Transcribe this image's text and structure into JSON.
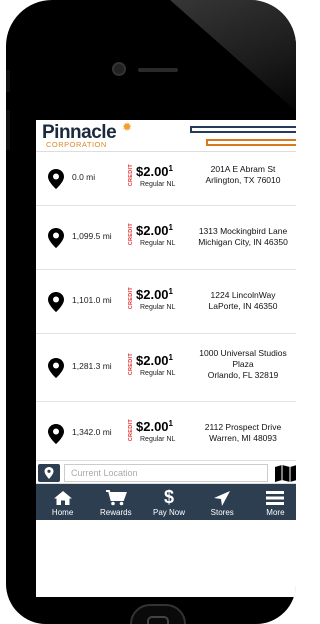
{
  "header": {
    "logo_text": "Pinnacle",
    "logo_sub": "CORPORATION"
  },
  "stations": [
    {
      "distance": "0.0 mi",
      "credit_label": "CREDIT",
      "price_main": "$2.00",
      "price_tenths": "1",
      "grade": "Regular NL",
      "address_line1": "201A E Abram St",
      "address_line2": "Arlington, TX 76010",
      "address_line3": ""
    },
    {
      "distance": "1,099.5 mi",
      "credit_label": "CREDIT",
      "price_main": "$2.00",
      "price_tenths": "1",
      "grade": "Regular NL",
      "address_line1": "1313 Mockingbird Lane",
      "address_line2": "Michigan City, IN 46350",
      "address_line3": ""
    },
    {
      "distance": "1,101.0 mi",
      "credit_label": "CREDIT",
      "price_main": "$2.00",
      "price_tenths": "1",
      "grade": "Regular NL",
      "address_line1": "1224 LincolnWay",
      "address_line2": "LaPorte, IN 46350",
      "address_line3": ""
    },
    {
      "distance": "1,281.3 mi",
      "credit_label": "CREDIT",
      "price_main": "$2.00",
      "price_tenths": "1",
      "grade": "Regular NL",
      "address_line1": "1000 Universal Studios",
      "address_line2": "Plaza",
      "address_line3": "Orlando, FL 32819"
    },
    {
      "distance": "1,342.0 mi",
      "credit_label": "CREDIT",
      "price_main": "$2.00",
      "price_tenths": "1",
      "grade": "Regular NL",
      "address_line1": "2112 Prospect Drive",
      "address_line2": "Warren, MI 48093",
      "address_line3": ""
    }
  ],
  "search": {
    "placeholder": "Current Location"
  },
  "nav": {
    "home": "Home",
    "rewards": "Rewards",
    "paynow": "Pay Now",
    "stores": "Stores",
    "more": "More"
  },
  "colors": {
    "nav_bg": "#2c3e50",
    "credit_red": "#e03030",
    "logo_orange": "#d98a26",
    "logo_navy": "#1d2a3c"
  }
}
